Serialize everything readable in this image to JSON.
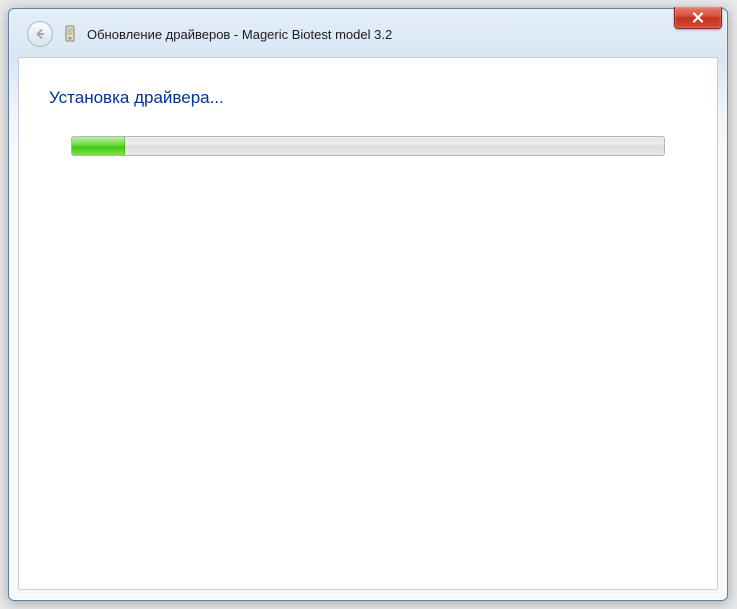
{
  "window": {
    "title": "Обновление драйверов - Mageric Biotest model 3.2",
    "close_label": "Close"
  },
  "content": {
    "heading": "Установка драйвера...",
    "progress_percent": 9
  }
}
